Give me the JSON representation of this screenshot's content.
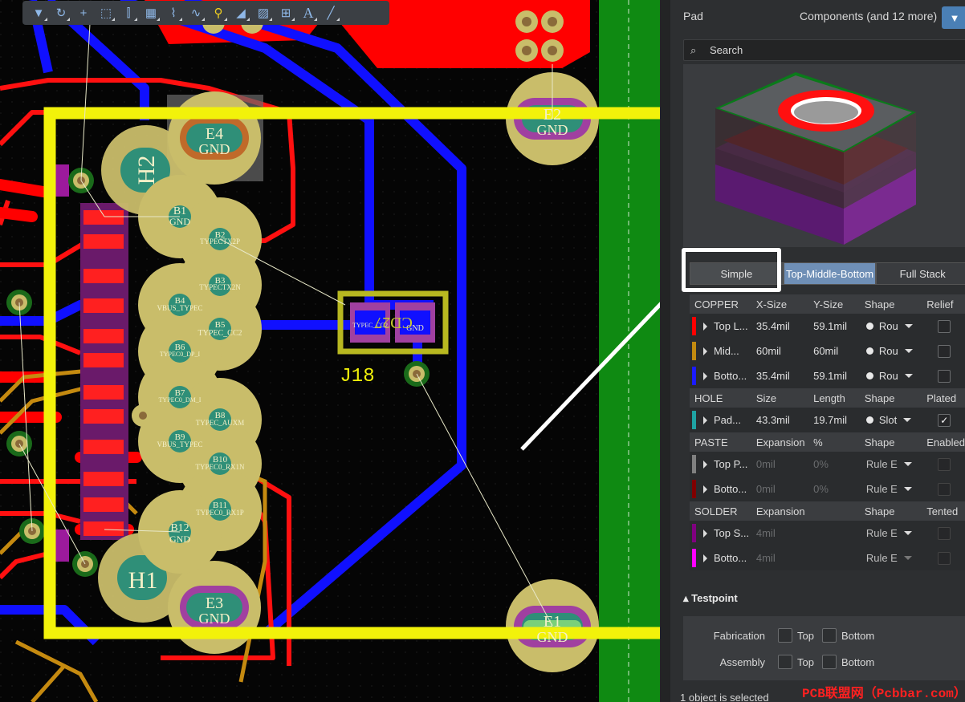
{
  "toolbar": {
    "items": [
      {
        "name": "filter-icon",
        "glyph": "▼"
      },
      {
        "name": "route-icon",
        "glyph": "↻"
      },
      {
        "name": "crosshair-icon",
        "glyph": "+"
      },
      {
        "name": "select-rect-icon",
        "glyph": "⬚"
      },
      {
        "name": "align-icon",
        "glyph": "⫿"
      },
      {
        "name": "component-icon",
        "glyph": "▦"
      },
      {
        "name": "track-icon",
        "glyph": "⌇"
      },
      {
        "name": "diff-pair-icon",
        "glyph": "∿"
      },
      {
        "name": "via-icon",
        "glyph": "⚲"
      },
      {
        "name": "polygon-icon",
        "glyph": "◢"
      },
      {
        "name": "region-icon",
        "glyph": "▨"
      },
      {
        "name": "chart-icon",
        "glyph": "⊞"
      },
      {
        "name": "text-icon",
        "glyph": "A"
      },
      {
        "name": "line-icon",
        "glyph": "╱"
      }
    ]
  },
  "pcb": {
    "designators": {
      "H2": "H2",
      "H1": "H1",
      "J18": "J18",
      "E4": "E4",
      "E2": "E2",
      "E3": "E3",
      "E1": "E1",
      "B1": "B1",
      "B2": "B2",
      "B3": "B3",
      "B4": "B4",
      "B5": "B5",
      "B6": "B6",
      "B7": "B7",
      "B8": "B8",
      "B9": "B9",
      "B10": "B10",
      "B11": "B11",
      "B12": "B12"
    },
    "nets": {
      "gnd": "GND",
      "b2": "TYPECTX2P",
      "b3": "TYPECTX2N",
      "b4": "VBUS_TYPEC",
      "b5": "TYPEC_CC2",
      "b6": "TYPEC0_DP_I",
      "b7": "TYPEC0_DM_I",
      "b8": "TYPEC_AUXM",
      "b9": "VBUS_TYPEC",
      "b10": "TYPEC0_RX1N",
      "b11": "TYPEC0_RX1P",
      "j18_left": "TYPEC_CC2",
      "j18_right": "GND",
      "j18_silk": "CD27"
    }
  },
  "panel": {
    "title": "Pad",
    "subtitle": "Components (and 12 more)",
    "search_placeholder": "Search",
    "stack_modes": [
      "Simple",
      "Top-Middle-Bottom",
      "Full Stack"
    ],
    "copper": {
      "headers": [
        "COPPER",
        "X-Size",
        "Y-Size",
        "Shape",
        "Relief"
      ],
      "rows": [
        {
          "name": "Top L...",
          "color": "#ff0000",
          "x": "35.4mil",
          "y": "59.1mil",
          "shape": "Rou"
        },
        {
          "name": "Mid...",
          "color": "#c28a10",
          "x": "60mil",
          "y": "60mil",
          "shape": "Rou"
        },
        {
          "name": "Botto...",
          "color": "#1b1bff",
          "x": "35.4mil",
          "y": "59.1mil",
          "shape": "Rou"
        }
      ]
    },
    "hole": {
      "headers": [
        "HOLE",
        "Size",
        "Length",
        "Shape",
        "Plated"
      ],
      "rows": [
        {
          "name": "Pad...",
          "color": "#1fa3a3",
          "x": "43.3mil",
          "y": "19.7mil",
          "shape": "Slot",
          "checked": true
        }
      ]
    },
    "paste": {
      "headers": [
        "PASTE",
        "Expansion",
        "%",
        "Shape",
        "Enabled"
      ],
      "rows": [
        {
          "name": "Top P...",
          "color": "#808080",
          "x": "0mil",
          "y": "0%",
          "shape": "Rule E"
        },
        {
          "name": "Botto...",
          "color": "#800000",
          "x": "0mil",
          "y": "0%",
          "shape": "Rule E"
        }
      ]
    },
    "solder": {
      "headers": [
        "SOLDER",
        "Expansion",
        "",
        "Shape",
        "Tented"
      ],
      "rows": [
        {
          "name": "Top S...",
          "color": "#800080",
          "x": "4mil",
          "y": "",
          "shape": "Rule E"
        },
        {
          "name": "Botto...",
          "color": "#ff00ff",
          "x": "4mil",
          "y": "",
          "shape": "Rule E"
        }
      ]
    },
    "testpoint": {
      "title": "Testpoint",
      "rows": [
        {
          "label": "Fabrication",
          "top": "Top",
          "bottom": "Bottom"
        },
        {
          "label": "Assembly",
          "top": "Top",
          "bottom": "Bottom"
        }
      ]
    },
    "status": "1 object is selected",
    "watermark": "PCB联盟网（Pcbbar.com）"
  }
}
